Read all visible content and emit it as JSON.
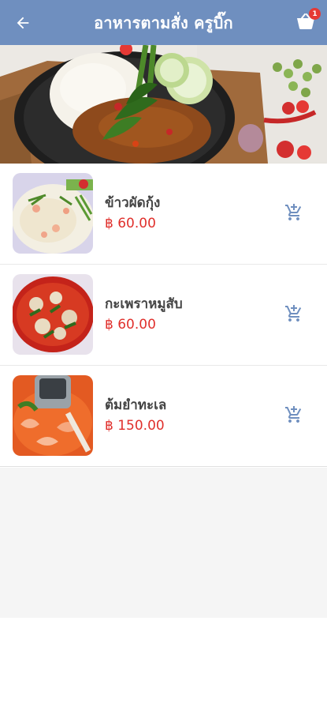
{
  "appbar": {
    "title": "อาหารตามสั่ง ครูบิ๊ก",
    "back_icon": "arrow-left-icon",
    "cart_icon": "cart-icon",
    "cart_badge": "1",
    "background_color": "#6f8fbf"
  },
  "banner": {
    "image": "thai-basil-pork-rice-photo"
  },
  "menu": {
    "items": [
      {
        "name": "ข้าวผัดกุ้ง",
        "price": "฿ 60.00",
        "image": "shrimp-fried-rice-photo",
        "action_icon": "add-to-cart-icon"
      },
      {
        "name": "กะเพราหมูสับ",
        "price": "฿ 60.00",
        "image": "basil-minced-pork-photo",
        "action_icon": "add-to-cart-icon"
      },
      {
        "name": "ต้มยำทะเล",
        "price": "฿ 150.00",
        "image": "seafood-tom-yum-photo",
        "action_icon": "add-to-cart-icon"
      }
    ]
  },
  "colors": {
    "price": "#e0302c",
    "name": "#444444",
    "icon": "#6f8fbf"
  }
}
